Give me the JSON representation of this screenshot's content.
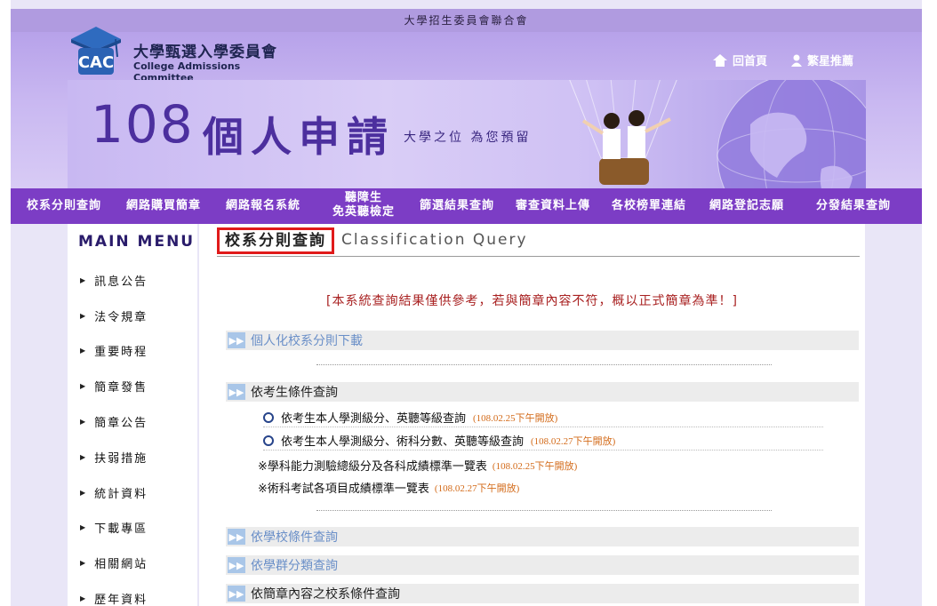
{
  "top_banner": {
    "org_name": "大學招生委員會聯合會"
  },
  "logo": {
    "title_cn": "大學甄選入學委員會",
    "title_en": "College Admissions Committee",
    "mark_text": "CAC"
  },
  "utility_links": [
    {
      "label": "回首頁",
      "icon": "home-icon"
    },
    {
      "label": "繁星推薦",
      "icon": "person-icon"
    }
  ],
  "banner": {
    "number": "108",
    "title": "個人申請",
    "subtitle": "大學之位 為您預留"
  },
  "nav": {
    "items": [
      {
        "label": "校系分則查詢"
      },
      {
        "label": "網路購買簡章"
      },
      {
        "label": "網路報名系統"
      },
      {
        "label_line1": "聽障生",
        "label_line2": "免英聽檢定"
      },
      {
        "label": "篩選結果查詢"
      },
      {
        "label": "審查資料上傳"
      },
      {
        "label": "各校榜單連結"
      },
      {
        "label": "網路登記志願"
      },
      {
        "label": "分發結果查詢"
      }
    ]
  },
  "sidebar": {
    "title": "MAIN MENU",
    "items": [
      {
        "label": "訊息公告"
      },
      {
        "label": "法令規章"
      },
      {
        "label": "重要時程"
      },
      {
        "label": "簡章發售"
      },
      {
        "label": "簡章公告"
      },
      {
        "label": "扶弱措施"
      },
      {
        "label": "統計資料"
      },
      {
        "label": "下載專區"
      },
      {
        "label": "相關網站"
      },
      {
        "label": "歷年資料"
      }
    ]
  },
  "main": {
    "page_title_cn": "校系分則查詢",
    "page_title_en": "Classification Query",
    "notice": "[本系統查詢結果僅供參考，若與簡章內容不符，概以正式簡章為準！]",
    "sections": [
      {
        "label": "個人化校系分則下載"
      },
      {
        "label": "依考生條件查詢"
      },
      {
        "label": "依學校條件查詢"
      },
      {
        "label": "依學群分類查詢"
      },
      {
        "label": "依簡章內容之校系條件查詢"
      }
    ],
    "candidate_queries": [
      {
        "label": "依考生本人學測級分、英聽等級查詢",
        "date": "(108.02.25下午開放)"
      },
      {
        "label": "依考生本人學測級分、術科分數、英聽等級查詢",
        "date": "(108.02.27下午開放)"
      }
    ],
    "reference_links": [
      {
        "label": "※學科能力測驗總級分及各科成績標準一覽表",
        "date": "(108.02.25下午開放)"
      },
      {
        "label": "※術科考試各項目成績標準一覽表",
        "date": "(108.02.27下午開放)"
      }
    ]
  },
  "colors": {
    "nav_bg": "#7c3dc5",
    "header_bg": "#b7a2ea",
    "crumb_border": "#e01a1a",
    "notice_text": "#a82020",
    "date_text": "#d36b1a",
    "section_link": "#6a8fc8"
  }
}
